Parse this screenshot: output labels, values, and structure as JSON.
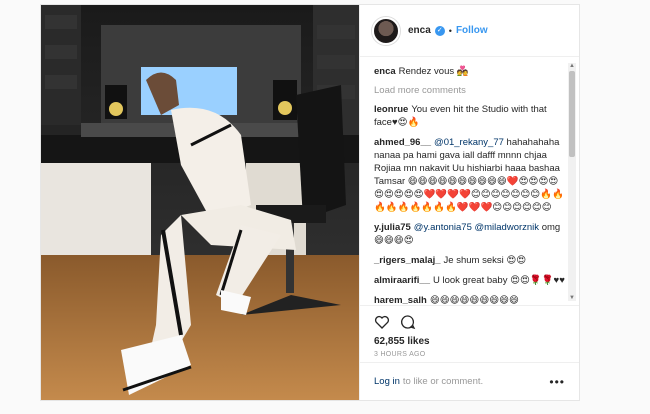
{
  "header": {
    "username": "enca",
    "follow_label": "Follow",
    "separator": "•"
  },
  "caption": {
    "user": "enca",
    "text": "Rendez vous 💑"
  },
  "load_more": "Load more comments",
  "comments": [
    {
      "user": "leonrue",
      "text": "You even hit the Studio with that face♥😍🔥"
    },
    {
      "user": "ahmed_96__",
      "mention": "@01_rekany_77",
      "text": "hahahahaha nanaa pa hami gava iall dafff mnnn chjaa Rojiaa mn nakavit Uu hishiarbi haaa bashaa Tamsar 😄😄😄😄😄😄😄😄😄😄❤️😍😍😍😍😍😍😍😍😍❤️❤️❤️❤️😊😊😊😊😊😊😊🔥🔥🔥🔥🔥🔥🔥🔥🔥❤️❤️❤️😊😊😊😊😊😊"
    },
    {
      "user": "y.julia75",
      "mention": "@y.antonia75 @miladworznik",
      "text": "omg 😄😄😄😍"
    },
    {
      "user": "_rigers_malaj_",
      "text": "Je shum seksi 😍😍"
    },
    {
      "user": "almiraarifi__",
      "text": "U look great baby 😍😍🌹🌹♥♥"
    },
    {
      "user": "harem_salh",
      "text": "😄😄😄😄😄😄😄😄😄"
    }
  ],
  "actions": {
    "likes": "62,855 likes",
    "time": "3 HOURS AGO"
  },
  "login": {
    "link": "Log in",
    "text": "to like or comment.",
    "more": "•••"
  }
}
